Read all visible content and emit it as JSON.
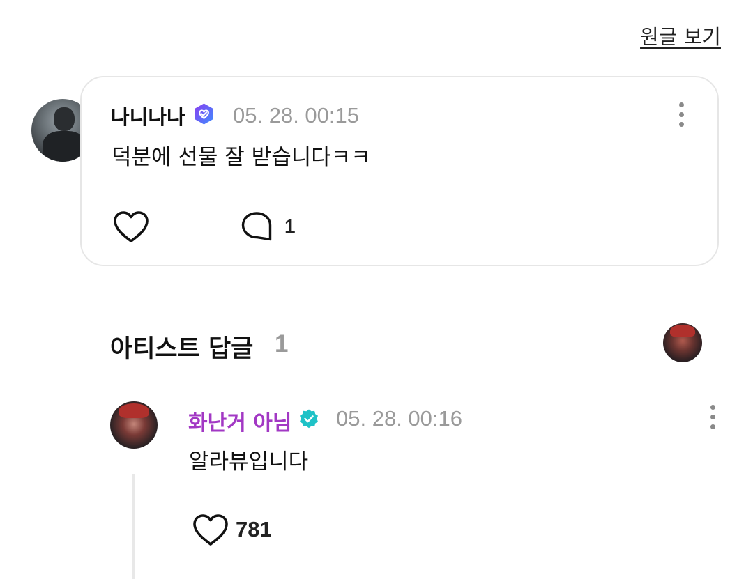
{
  "header": {
    "view_original_label": "원글 보기"
  },
  "comment": {
    "author": "나니나나",
    "timestamp": "05. 28. 00:15",
    "text": "덕분에 선물 잘 받습니다ㅋㅋ",
    "reply_count": "1",
    "icons": [
      "heart-outline-icon",
      "speech-bubble-icon",
      "more-vertical-icon",
      "fan-verified-badge-icon"
    ]
  },
  "artist_section": {
    "title": "아티스트 답글",
    "count": "1"
  },
  "artist_reply": {
    "author": "화난거 아님",
    "timestamp": "05. 28. 00:16",
    "text": "알라뷰입니다",
    "like_count": "781",
    "icons": [
      "heart-outline-icon",
      "more-vertical-icon",
      "artist-verified-badge-icon"
    ]
  },
  "colors": {
    "artist_name": "#a238c4",
    "timestamp": "#9a9a9a",
    "card_border": "#e6e6e6",
    "fan_badge_gradient": [
      "#7b3ff2",
      "#3f8cff"
    ],
    "artist_badge": "#1fc2c7"
  }
}
